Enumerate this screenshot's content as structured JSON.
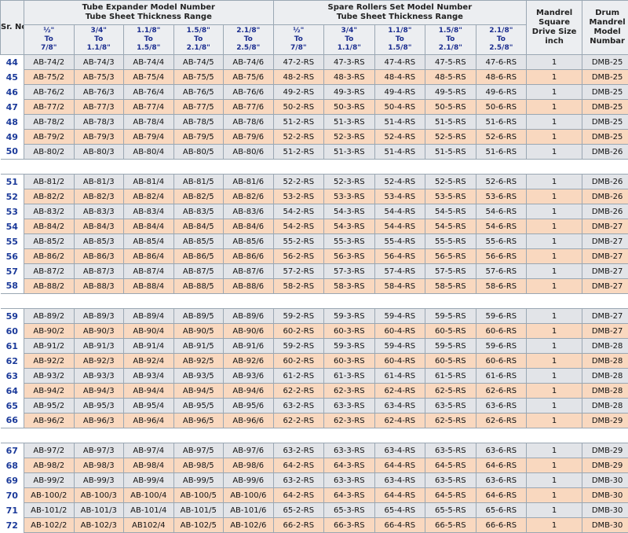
{
  "header": {
    "sr": "Sr. No.",
    "tube_expander_title_1": "Tube Expander Model Number",
    "tube_expander_title_2": "Tube Sheet Thickness Range",
    "spare_rollers_title_1": "Spare Rollers Set Model Number",
    "spare_rollers_title_2": "Tube Sheet Thickness Range",
    "mandrel": "Mandrel Square Drive Size inch",
    "drum": "Drum Mandrel Model Numbar",
    "ranges": [
      {
        "a": "½\"",
        "b": "To",
        "c": "7/8\""
      },
      {
        "a": "3/4\"",
        "b": "To",
        "c": "1.1/8\""
      },
      {
        "a": "1.1/8\"",
        "b": "To",
        "c": "1.5/8\""
      },
      {
        "a": "1.5/8\"",
        "b": "To",
        "c": "2.1/8\""
      },
      {
        "a": "2.1/8\"",
        "b": "To",
        "c": "2.5/8\""
      },
      {
        "a": "½\"",
        "b": "To",
        "c": "7/8\""
      },
      {
        "a": "3/4\"",
        "b": "To",
        "c": "1.1/8\""
      },
      {
        "a": "1.1/8\"",
        "b": "To",
        "c": "1.5/8\""
      },
      {
        "a": "1.5/8\"",
        "b": "To",
        "c": "2.1/8\""
      },
      {
        "a": "2.1/8\"",
        "b": "To",
        "c": "2.5/8\""
      }
    ]
  },
  "groups": [
    [
      [
        "44",
        "AB-74/2",
        "AB-74/3",
        "AB-74/4",
        "AB-74/5",
        "AB-74/6",
        "47-2-RS",
        "47-3-RS",
        "47-4-RS",
        "47-5-RS",
        "47-6-RS",
        "1",
        "DMB-25"
      ],
      [
        "45",
        "AB-75/2",
        "AB-75/3",
        "AB-75/4",
        "AB-75/5",
        "AB-75/6",
        "48-2-RS",
        "48-3-RS",
        "48-4-RS",
        "48-5-RS",
        "48-6-RS",
        "1",
        "DMB-25"
      ],
      [
        "46",
        "AB-76/2",
        "AB-76/3",
        "AB-76/4",
        "AB-76/5",
        "AB-76/6",
        "49-2-RS",
        "49-3-RS",
        "49-4-RS",
        "49-5-RS",
        "49-6-RS",
        "1",
        "DMB-25"
      ],
      [
        "47",
        "AB-77/2",
        "AB-77/3",
        "AB-77/4",
        "AB-77/5",
        "AB-77/6",
        "50-2-RS",
        "50-3-RS",
        "50-4-RS",
        "50-5-RS",
        "50-6-RS",
        "1",
        "DMB-25"
      ],
      [
        "48",
        "AB-78/2",
        "AB-78/3",
        "AB-78/4",
        "AB-78/5",
        "AB-78/6",
        "51-2-RS",
        "51-3-RS",
        "51-4-RS",
        "51-5-RS",
        "51-6-RS",
        "1",
        "DMB-25"
      ],
      [
        "49",
        "AB-79/2",
        "AB-79/3",
        "AB-79/4",
        "AB-79/5",
        "AB-79/6",
        "52-2-RS",
        "52-3-RS",
        "52-4-RS",
        "52-5-RS",
        "52-6-RS",
        "1",
        "DMB-25"
      ],
      [
        "50",
        "AB-80/2",
        "AB-80/3",
        "AB-80/4",
        "AB-80/5",
        "AB-80/6",
        "51-2-RS",
        "51-3-RS",
        "51-4-RS",
        "51-5-RS",
        "51-6-RS",
        "1",
        "DMB-26"
      ]
    ],
    [
      [
        "51",
        "AB-81/2",
        "AB-81/3",
        "AB-81/4",
        "AB-81/5",
        "AB-81/6",
        "52-2-RS",
        "52-3-RS",
        "52-4-RS",
        "52-5-RS",
        "52-6-RS",
        "1",
        "DMB-26"
      ],
      [
        "52",
        "AB-82/2",
        "AB-82/3",
        "AB-82/4",
        "AB-82/5",
        "AB-82/6",
        "53-2-RS",
        "53-3-RS",
        "53-4-RS",
        "53-5-RS",
        "53-6-RS",
        "1",
        "DMB-26"
      ],
      [
        "53",
        "AB-83/2",
        "AB-83/3",
        "AB-83/4",
        "AB-83/5",
        "AB-83/6",
        "54-2-RS",
        "54-3-RS",
        "54-4-RS",
        "54-5-RS",
        "54-6-RS",
        "1",
        "DMB-26"
      ],
      [
        "54",
        "AB-84/2",
        "AB-84/3",
        "AB-84/4",
        "AB-84/5",
        "AB-84/6",
        "54-2-RS",
        "54-3-RS",
        "54-4-RS",
        "54-5-RS",
        "54-6-RS",
        "1",
        "DMB-27"
      ],
      [
        "55",
        "AB-85/2",
        "AB-85/3",
        "AB-85/4",
        "AB-85/5",
        "AB-85/6",
        "55-2-RS",
        "55-3-RS",
        "55-4-RS",
        "55-5-RS",
        "55-6-RS",
        "1",
        "DMB-27"
      ],
      [
        "56",
        "AB-86/2",
        "AB-86/3",
        "AB-86/4",
        "AB-86/5",
        "AB-86/6",
        "56-2-RS",
        "56-3-RS",
        "56-4-RS",
        "56-5-RS",
        "56-6-RS",
        "1",
        "DMB-27"
      ],
      [
        "57",
        "AB-87/2",
        "AB-87/3",
        "AB-87/4",
        "AB-87/5",
        "AB-87/6",
        "57-2-RS",
        "57-3-RS",
        "57-4-RS",
        "57-5-RS",
        "57-6-RS",
        "1",
        "DMB-27"
      ],
      [
        "58",
        "AB-88/2",
        "AB-88/3",
        "AB-88/4",
        "AB-88/5",
        "AB-88/6",
        "58-2-RS",
        "58-3-RS",
        "58-4-RS",
        "58-5-RS",
        "58-6-RS",
        "1",
        "DMB-27"
      ]
    ],
    [
      [
        "59",
        "AB-89/2",
        "AB-89/3",
        "AB-89/4",
        "AB-89/5",
        "AB-89/6",
        "59-2-RS",
        "59-3-RS",
        "59-4-RS",
        "59-5-RS",
        "59-6-RS",
        "1",
        "DMB-27"
      ],
      [
        "60",
        "AB-90/2",
        "AB-90/3",
        "AB-90/4",
        "AB-90/5",
        "AB-90/6",
        "60-2-RS",
        "60-3-RS",
        "60-4-RS",
        "60-5-RS",
        "60-6-RS",
        "1",
        "DMB-27"
      ],
      [
        "61",
        "AB-91/2",
        "AB-91/3",
        "AB-91/4",
        "AB-91/5",
        "AB-91/6",
        "59-2-RS",
        "59-3-RS",
        "59-4-RS",
        "59-5-RS",
        "59-6-RS",
        "1",
        "DMB-28"
      ],
      [
        "62",
        "AB-92/2",
        "AB-92/3",
        "AB-92/4",
        "AB-92/5",
        "AB-92/6",
        "60-2-RS",
        "60-3-RS",
        "60-4-RS",
        "60-5-RS",
        "60-6-RS",
        "1",
        "DMB-28"
      ],
      [
        "63",
        "AB-93/2",
        "AB-93/3",
        "AB-93/4",
        "AB-93/5",
        "AB-93/6",
        "61-2-RS",
        "61-3-RS",
        "61-4-RS",
        "61-5-RS",
        "61-6-RS",
        "1",
        "DMB-28"
      ],
      [
        "64",
        "AB-94/2",
        "AB-94/3",
        "AB-94/4",
        "AB-94/5",
        "AB-94/6",
        "62-2-RS",
        "62-3-RS",
        "62-4-RS",
        "62-5-RS",
        "62-6-RS",
        "1",
        "DMB-28"
      ],
      [
        "65",
        "AB-95/2",
        "AB-95/3",
        "AB-95/4",
        "AB-95/5",
        "AB-95/6",
        "63-2-RS",
        "63-3-RS",
        "63-4-RS",
        "63-5-RS",
        "63-6-RS",
        "1",
        "DMB-28"
      ],
      [
        "66",
        "AB-96/2",
        "AB-96/3",
        "AB-96/4",
        "AB-96/5",
        "AB-96/6",
        "62-2-RS",
        "62-3-RS",
        "62-4-RS",
        "62-5-RS",
        "62-6-RS",
        "1",
        "DMB-29"
      ]
    ],
    [
      [
        "67",
        "AB-97/2",
        "AB-97/3",
        "AB-97/4",
        "AB-97/5",
        "AB-97/6",
        "63-2-RS",
        "63-3-RS",
        "63-4-RS",
        "63-5-RS",
        "63-6-RS",
        "1",
        "DMB-29"
      ],
      [
        "68",
        "AB-98/2",
        "AB-98/3",
        "AB-98/4",
        "AB-98/5",
        "AB-98/6",
        "64-2-RS",
        "64-3-RS",
        "64-4-RS",
        "64-5-RS",
        "64-6-RS",
        "1",
        "DMB-29"
      ],
      [
        "69",
        "AB-99/2",
        "AB-99/3",
        "AB-99/4",
        "AB-99/5",
        "AB-99/6",
        "63-2-RS",
        "63-3-RS",
        "63-4-RS",
        "63-5-RS",
        "63-6-RS",
        "1",
        "DMB-30"
      ],
      [
        "70",
        "AB-100/2",
        "AB-100/3",
        "AB-100/4",
        "AB-100/5",
        "AB-100/6",
        "64-2-RS",
        "64-3-RS",
        "64-4-RS",
        "64-5-RS",
        "64-6-RS",
        "1",
        "DMB-30"
      ],
      [
        "71",
        "AB-101/2",
        "AB-101/3",
        "AB-101/4",
        "AB-101/5",
        "AB-101/6",
        "65-2-RS",
        "65-3-RS",
        "65-4-RS",
        "65-5-RS",
        "65-6-RS",
        "1",
        "DMB-30"
      ],
      [
        "72",
        "AB-102/2",
        "AB-102/3",
        "AB102/4",
        "AB-102/5",
        "AB-102/6",
        "66-2-RS",
        "66-3-RS",
        "66-4-RS",
        "66-5-RS",
        "66-6-RS",
        "1",
        "DMB-30"
      ]
    ]
  ],
  "colors": {
    "peach": "#f9d8bf",
    "grey": "#e2e4e8",
    "sr_text": "#1b3a9a",
    "range_text": "#1b2d8f"
  }
}
